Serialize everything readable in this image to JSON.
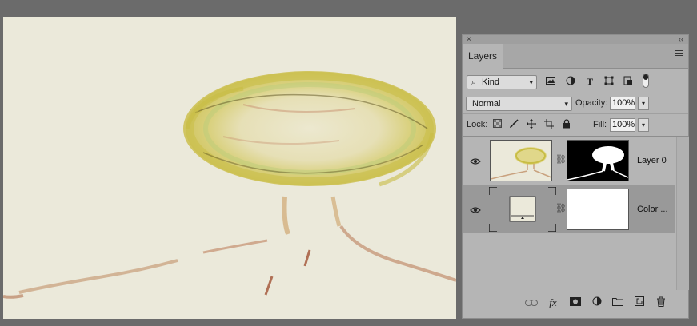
{
  "panel": {
    "close_symbol": "×",
    "collapse_symbol": "‹‹",
    "tab_label": "Layers",
    "menu_icon": "hamburger-menu-icon"
  },
  "filter": {
    "kind_label": "Kind",
    "icons": [
      "image-filter-icon",
      "adjustment-filter-icon",
      "type-filter-icon",
      "shape-filter-icon",
      "smart-object-filter-icon"
    ]
  },
  "blend": {
    "mode": "Normal",
    "opacity_label": "Opacity:",
    "opacity_value": "100%"
  },
  "lock": {
    "label": "Lock:",
    "fill_label": "Fill:",
    "fill_value": "100%"
  },
  "layers": [
    {
      "name": "Layer 0",
      "visible": true,
      "has_mask": true,
      "mask_fill": "#000000"
    },
    {
      "name": "Color ...",
      "visible": true,
      "has_mask": true,
      "selected": true,
      "swatch": "#ebe9da",
      "mask_fill": "#ffffff"
    }
  ],
  "bottom_icons": [
    "link-layers-icon",
    "fx-icon",
    "add-mask-icon",
    "adjustment-layer-icon",
    "new-group-icon",
    "new-layer-icon",
    "trash-icon"
  ],
  "colors": {
    "canvas_bg": "#ebe9da",
    "workspace": "#6b6b6b",
    "panel_bg": "#b5b5b5",
    "selected_layer": "#999999"
  }
}
